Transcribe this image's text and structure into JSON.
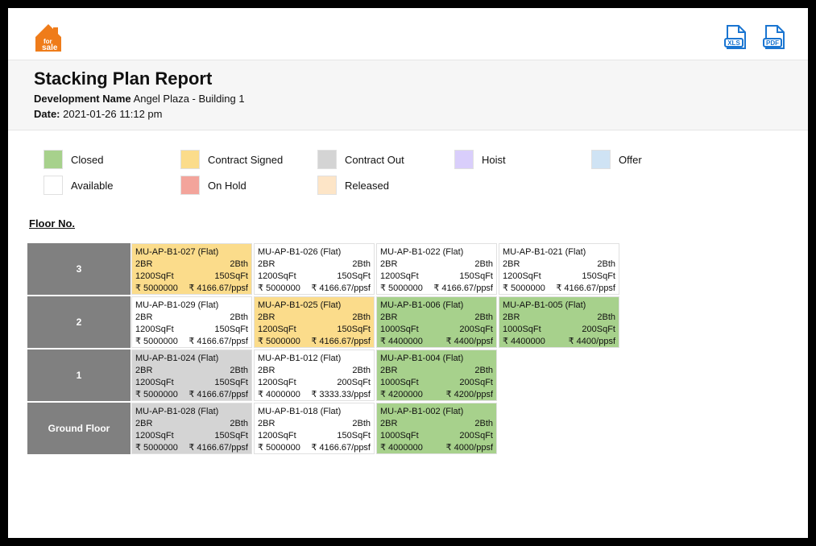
{
  "report": {
    "title": "Stacking Plan Report",
    "dev_label": "Development Name",
    "dev_value": "Angel Plaza - Building 1",
    "date_label": "Date:",
    "date_value": "2021-01-26 11:12 pm"
  },
  "legend": [
    {
      "key": "Closed",
      "label": "Closed",
      "color": "#a7d18c"
    },
    {
      "key": "ContractSigned",
      "label": "Contract Signed",
      "color": "#fbdc8b"
    },
    {
      "key": "ContractOut",
      "label": "Contract Out",
      "color": "#d4d4d4"
    },
    {
      "key": "Hoist",
      "label": "Hoist",
      "color": "#d9cefb"
    },
    {
      "key": "Offer",
      "label": "Offer",
      "color": "#cfe3f4"
    },
    {
      "key": "Available",
      "label": "Available",
      "color": "#ffffff"
    },
    {
      "key": "OnHold",
      "label": "On Hold",
      "color": "#f3a49b"
    },
    {
      "key": "Released",
      "label": "Released",
      "color": "#fde5c7"
    }
  ],
  "section_label": "Floor No.",
  "floors": [
    {
      "label": "3",
      "units": [
        {
          "code": "MU-AP-B1-027 (Flat)",
          "br": "2BR",
          "bth": "2Bth",
          "area": "1200SqFt",
          "psf_area": "150SqFt",
          "price": "₹ 5000000",
          "psf": "₹ 4166.67/ppsf",
          "status": "ContractSigned"
        },
        {
          "code": "MU-AP-B1-026 (Flat)",
          "br": "2BR",
          "bth": "2Bth",
          "area": "1200SqFt",
          "psf_area": "150SqFt",
          "price": "₹ 5000000",
          "psf": "₹ 4166.67/ppsf",
          "status": "Available"
        },
        {
          "code": "MU-AP-B1-022 (Flat)",
          "br": "2BR",
          "bth": "2Bth",
          "area": "1200SqFt",
          "psf_area": "150SqFt",
          "price": "₹ 5000000",
          "psf": "₹ 4166.67/ppsf",
          "status": "Available"
        },
        {
          "code": "MU-AP-B1-021 (Flat)",
          "br": "2BR",
          "bth": "2Bth",
          "area": "1200SqFt",
          "psf_area": "150SqFt",
          "price": "₹ 5000000",
          "psf": "₹ 4166.67/ppsf",
          "status": "Available"
        }
      ]
    },
    {
      "label": "2",
      "units": [
        {
          "code": "MU-AP-B1-029 (Flat)",
          "br": "2BR",
          "bth": "2Bth",
          "area": "1200SqFt",
          "psf_area": "150SqFt",
          "price": "₹ 5000000",
          "psf": "₹ 4166.67/ppsf",
          "status": "Available"
        },
        {
          "code": "MU-AP-B1-025 (Flat)",
          "br": "2BR",
          "bth": "2Bth",
          "area": "1200SqFt",
          "psf_area": "150SqFt",
          "price": "₹ 5000000",
          "psf": "₹ 4166.67/ppsf",
          "status": "ContractSigned"
        },
        {
          "code": "MU-AP-B1-006 (Flat)",
          "br": "2BR",
          "bth": "2Bth",
          "area": "1000SqFt",
          "psf_area": "200SqFt",
          "price": "₹ 4400000",
          "psf": "₹ 4400/ppsf",
          "status": "Closed"
        },
        {
          "code": "MU-AP-B1-005 (Flat)",
          "br": "2BR",
          "bth": "2Bth",
          "area": "1000SqFt",
          "psf_area": "200SqFt",
          "price": "₹ 4400000",
          "psf": "₹ 4400/ppsf",
          "status": "Closed"
        }
      ]
    },
    {
      "label": "1",
      "units": [
        {
          "code": "MU-AP-B1-024 (Flat)",
          "br": "2BR",
          "bth": "2Bth",
          "area": "1200SqFt",
          "psf_area": "150SqFt",
          "price": "₹ 5000000",
          "psf": "₹ 4166.67/ppsf",
          "status": "ContractOut"
        },
        {
          "code": "MU-AP-B1-012 (Flat)",
          "br": "2BR",
          "bth": "2Bth",
          "area": "1200SqFt",
          "psf_area": "200SqFt",
          "price": "₹ 4000000",
          "psf": "₹ 3333.33/ppsf",
          "status": "Available"
        },
        {
          "code": "MU-AP-B1-004 (Flat)",
          "br": "2BR",
          "bth": "2Bth",
          "area": "1000SqFt",
          "psf_area": "200SqFt",
          "price": "₹ 4200000",
          "psf": "₹ 4200/ppsf",
          "status": "Closed"
        }
      ]
    },
    {
      "label": "Ground Floor",
      "units": [
        {
          "code": "MU-AP-B1-028 (Flat)",
          "br": "2BR",
          "bth": "2Bth",
          "area": "1200SqFt",
          "psf_area": "150SqFt",
          "price": "₹ 5000000",
          "psf": "₹ 4166.67/ppsf",
          "status": "ContractOut"
        },
        {
          "code": "MU-AP-B1-018 (Flat)",
          "br": "2BR",
          "bth": "2Bth",
          "area": "1200SqFt",
          "psf_area": "150SqFt",
          "price": "₹ 5000000",
          "psf": "₹ 4166.67/ppsf",
          "status": "Available"
        },
        {
          "code": "MU-AP-B1-002 (Flat)",
          "br": "2BR",
          "bth": "2Bth",
          "area": "1000SqFt",
          "psf_area": "200SqFt",
          "price": "₹ 4000000",
          "psf": "₹ 4000/ppsf",
          "status": "Closed"
        }
      ]
    }
  ]
}
